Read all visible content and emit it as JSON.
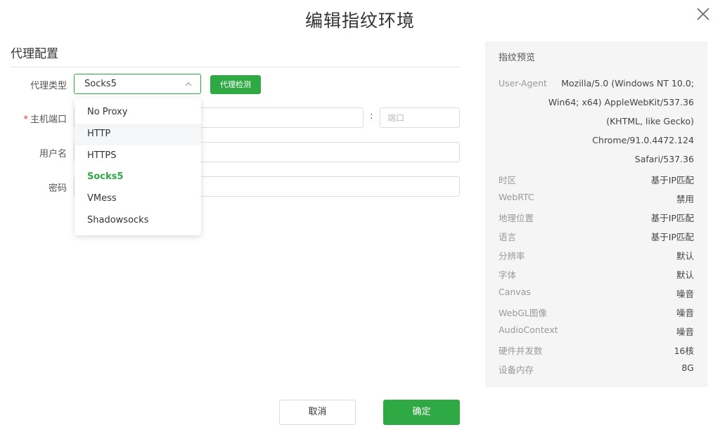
{
  "dialog": {
    "title": "编辑指纹环境"
  },
  "proxy_section": {
    "title": "代理配置",
    "type_label": "代理类型",
    "type_selected": "Socks5",
    "check_button": "代理检测",
    "host_label": "主机端口",
    "host_required_mark": "*",
    "host_placeholder": "",
    "port_separator": ":",
    "port_placeholder": "端口",
    "username_label": "用户名",
    "password_label": "密码"
  },
  "dropdown": {
    "options": [
      "No Proxy",
      "HTTP",
      "HTTPS",
      "Socks5",
      "VMess",
      "Shadowsocks"
    ],
    "hovered": "HTTP",
    "selected": "Socks5"
  },
  "footer": {
    "cancel_label": "取消",
    "ok_label": "确定"
  },
  "preview": {
    "title": "指纹预览",
    "user_agent_label": "User-Agent",
    "user_agent_lines": [
      "Mozilla/5.0 (Windows NT 10.0;",
      "Win64; x64) AppleWebKit/537.36",
      "(KHTML, like Gecko)",
      "Chrome/91.0.4472.124",
      "Safari/537.36"
    ],
    "rows": [
      {
        "label": "时区",
        "value": "基于IP匹配"
      },
      {
        "label": "WebRTC",
        "value": "禁用"
      },
      {
        "label": "地理位置",
        "value": "基于IP匹配"
      },
      {
        "label": "语言",
        "value": "基于IP匹配"
      },
      {
        "label": "分辨率",
        "value": "默认"
      },
      {
        "label": "字体",
        "value": "默认"
      },
      {
        "label": "Canvas",
        "value": "噪音"
      },
      {
        "label": "WebGL图像",
        "value": "噪音"
      },
      {
        "label": "AudioContext",
        "value": "噪音"
      },
      {
        "label": "硬件并发数",
        "value": "16核"
      },
      {
        "label": "设备内存",
        "value": "8G"
      }
    ]
  },
  "colors": {
    "accent": "#2fa944",
    "required": "#e53935",
    "preview_bg": "#f5f5f5"
  },
  "icons": {
    "close": "close-icon",
    "select_arrow": "chevron-up-icon"
  }
}
